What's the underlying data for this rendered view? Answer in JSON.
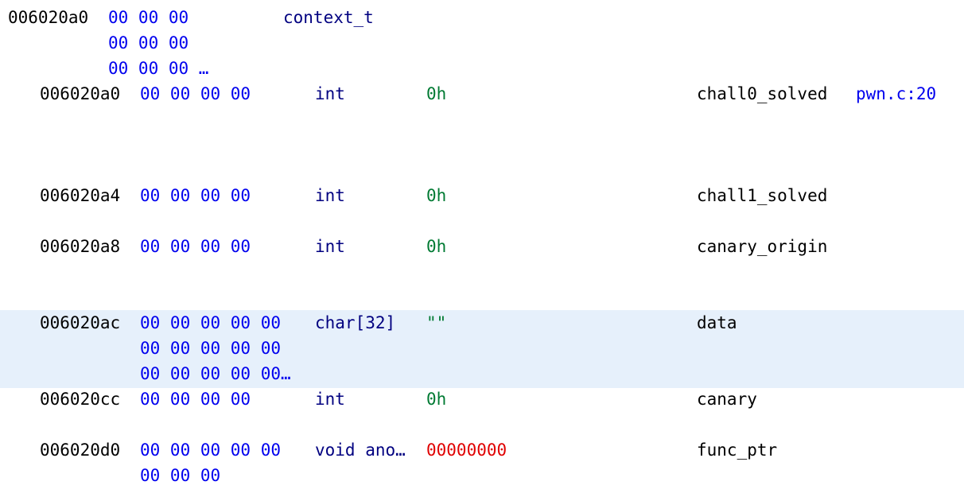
{
  "structure": {
    "address": "006020a0",
    "bytes_lines": [
      "00 00 00",
      "00 00 00",
      "00 00 00 …"
    ],
    "type": "context_t"
  },
  "fields": [
    {
      "address": "006020a0",
      "bytes_lines": [
        "00 00 00 00"
      ],
      "type": "int",
      "value": "0h",
      "name": "chall0_solved",
      "ref": "pwn.c:20"
    },
    {
      "address": "006020a4",
      "bytes_lines": [
        "00 00 00 00"
      ],
      "type": "int",
      "value": "0h",
      "name": "chall1_solved"
    },
    {
      "address": "006020a8",
      "bytes_lines": [
        "00 00 00 00"
      ],
      "type": "int",
      "value": "0h",
      "name": "canary_origin"
    },
    {
      "address": "006020ac",
      "bytes_lines": [
        "00 00 00 00 00",
        "00 00 00 00 00",
        "00 00 00 00 00…"
      ],
      "type": "char[32]",
      "value": "\"\"",
      "name": "data",
      "selected": true
    },
    {
      "address": "006020cc",
      "bytes_lines": [
        "00 00 00 00"
      ],
      "type": "int",
      "value": "0h",
      "name": "canary"
    },
    {
      "address": "006020d0",
      "bytes_lines": [
        "00 00 00 00 00",
        "00 00 00"
      ],
      "type": "void ano…",
      "value": "00000000",
      "name": "func_ptr"
    }
  ],
  "colors": {
    "address": "#000000",
    "bytes": "#0000ee",
    "type": "#000080",
    "value": "#007a33",
    "pointer_value": "#e00000",
    "selection": "#e6f0fb"
  }
}
